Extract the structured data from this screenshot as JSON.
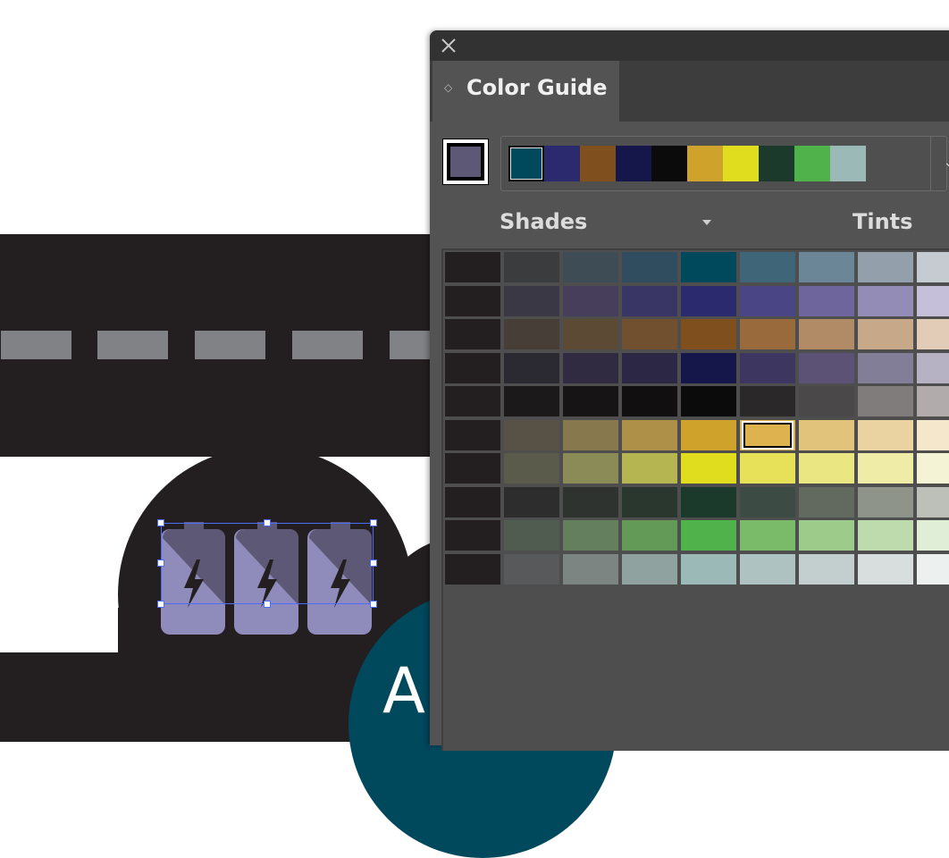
{
  "panel": {
    "tab_label": "Color Guide",
    "base_color": "#5c5875",
    "harmony_colors": [
      "#00485c",
      "#2b2a6e",
      "#7f4f1e",
      "#15164a",
      "#0b0b0b",
      "#cfa22c",
      "#e0dc1e",
      "#1b3a2c",
      "#4fb24a",
      "#9ab9b7"
    ],
    "selected_harmony_index": 0,
    "mode_left_label": "Shades",
    "mode_right_label": "Tints",
    "selected_cell": {
      "row": 5,
      "col": 5
    },
    "grid_rows": [
      [
        "#231f20",
        "#3a3c3e",
        "#3d4c55",
        "#2f4d5e",
        "#00485c",
        "#3f6678",
        "#6a8697",
        "#939fab",
        "#c6cbd1"
      ],
      [
        "#231f20",
        "#3a3845",
        "#473e5c",
        "#393665",
        "#2b2a6e",
        "#4a4686",
        "#6d659c",
        "#938cb7",
        "#c5bfd9"
      ],
      [
        "#231f20",
        "#463e37",
        "#5c4a35",
        "#70502e",
        "#7f4f1e",
        "#996a3b",
        "#b08b66",
        "#c7a98a",
        "#e2ccb7"
      ],
      [
        "#231f20",
        "#2b2a33",
        "#312b42",
        "#2b2745",
        "#15164a",
        "#3c3661",
        "#5b5275",
        "#837e97",
        "#b6b1c3"
      ],
      [
        "#231f20",
        "#1b191a",
        "#161415",
        "#110f10",
        "#0b0b0b",
        "#2a2829",
        "#4a4849",
        "#807c7b",
        "#b1acab"
      ],
      [
        "#231f20",
        "#575245",
        "#88784e",
        "#ae9049",
        "#cfa22c",
        "#ddb24f",
        "#e1c37c",
        "#ead3a0",
        "#f4e7cb"
      ],
      [
        "#231f20",
        "#5a5b4a",
        "#8b8b58",
        "#b5b651",
        "#e0dc1e",
        "#e7e15a",
        "#eae783",
        "#efeca7",
        "#f5f3d5"
      ],
      [
        "#231f20",
        "#2d2d2d",
        "#2e332f",
        "#2a372f",
        "#1b3a2c",
        "#3c4c44",
        "#62695f",
        "#8e948a",
        "#bcc0b8"
      ],
      [
        "#231f20",
        "#4f5c4f",
        "#647f5e",
        "#649a58",
        "#4fb24a",
        "#79bb68",
        "#9ccb8a",
        "#bedbae",
        "#e0eed8"
      ],
      [
        "#231f20",
        "#58595b",
        "#7d8583",
        "#8fa29f",
        "#9ab9b7",
        "#aec3c1",
        "#c2cfce",
        "#d7dedd",
        "#ecf0ef"
      ]
    ]
  },
  "artwork": {
    "heading_fragment": "A",
    "road_color": "#231f20",
    "dash_color": "#808285",
    "teal_color": "#00485c",
    "battery_color": "#8f8cbb",
    "battery_shade_color": "#5c5875",
    "bolt_color": "#231f20",
    "selection_color": "#4d6dff"
  }
}
